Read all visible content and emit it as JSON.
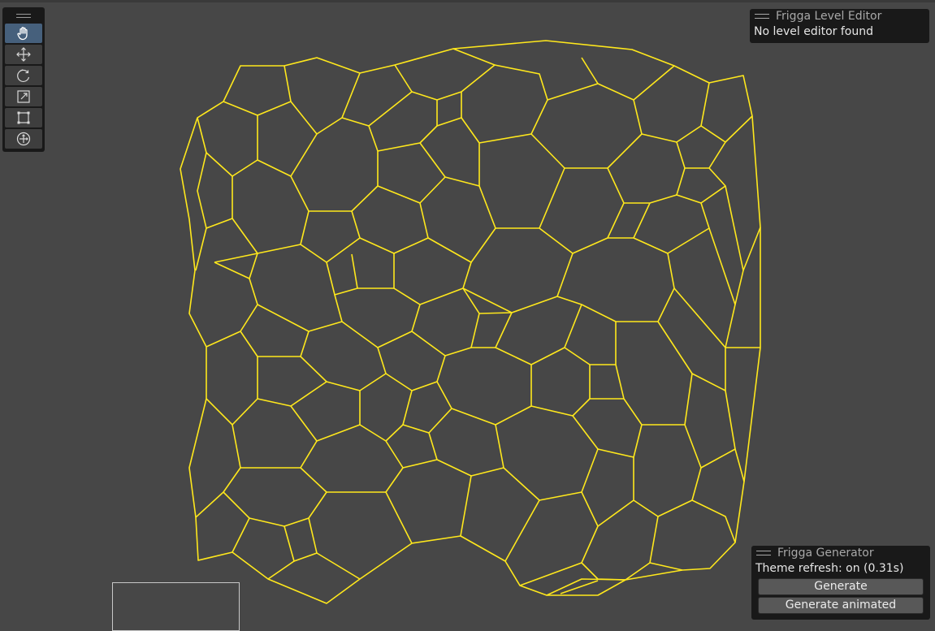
{
  "colors": {
    "background": "#474747",
    "graph_edge": "#ffe81c",
    "panel_bg": "#191919",
    "active_tool": "#46607c"
  },
  "toolbar": {
    "tools": [
      {
        "name": "hand-tool",
        "icon": "hand-icon",
        "active": true
      },
      {
        "name": "move-tool",
        "icon": "move-arrows-icon",
        "active": false
      },
      {
        "name": "rotate-tool",
        "icon": "rotate-icon",
        "active": false
      },
      {
        "name": "scale-tool",
        "icon": "scale-icon",
        "active": false
      },
      {
        "name": "rect-tool",
        "icon": "rect-transform-icon",
        "active": false
      },
      {
        "name": "transform-tool",
        "icon": "transform-icon",
        "active": false
      }
    ]
  },
  "level_editor": {
    "title": "Frigga Level Editor",
    "message": "No level editor found"
  },
  "generator": {
    "title": "Frigga Generator",
    "theme_refresh": "Theme refresh: on (0.31s)",
    "generate_label": "Generate",
    "generate_animated_label": "Generate animated"
  }
}
